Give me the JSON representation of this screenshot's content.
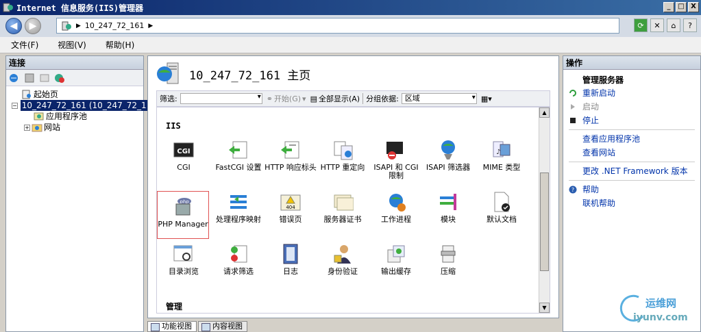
{
  "window": {
    "title": "Internet 信息服务(IIS)管理器",
    "buttons": [
      "_",
      "□",
      "X"
    ]
  },
  "address": {
    "crumb": "10_247_72_161"
  },
  "menu": [
    "文件(F)",
    "视图(V)",
    "帮助(H)"
  ],
  "connections": {
    "header": "连接",
    "tree": [
      {
        "label": "起始页"
      },
      {
        "label": "10_247_72_161 (10_247_72_1"
      },
      {
        "label": "应用程序池"
      },
      {
        "label": "网站"
      }
    ]
  },
  "center": {
    "title": "10_247_72_161 主页",
    "filter": {
      "label": "筛选:",
      "start": "开始(G)",
      "show_all": "全部显示(A)",
      "group_by_label": "分组依据:",
      "group_by_value": "区域"
    },
    "sections": {
      "iis": "IIS",
      "manage": "管理"
    },
    "features": [
      {
        "label": "CGI",
        "icon": "cgi-icon"
      },
      {
        "label": "FastCGI 设置",
        "icon": "fastcgi-icon"
      },
      {
        "label": "HTTP 响应标头",
        "icon": "http-headers-icon"
      },
      {
        "label": "HTTP 重定向",
        "icon": "http-redirect-icon"
      },
      {
        "label": "ISAPI 和 CGI 限制",
        "icon": "isapi-cgi-icon"
      },
      {
        "label": "ISAPI 筛选器",
        "icon": "isapi-filter-icon"
      },
      {
        "label": "MIME 类型",
        "icon": "mime-icon"
      },
      {
        "label": "PHP Manager",
        "icon": "php-manager-icon"
      },
      {
        "label": "处理程序映射",
        "icon": "handler-mapping-icon"
      },
      {
        "label": "错误页",
        "icon": "error-page-icon"
      },
      {
        "label": "服务器证书",
        "icon": "certificate-icon"
      },
      {
        "label": "工作进程",
        "icon": "worker-process-icon"
      },
      {
        "label": "模块",
        "icon": "modules-icon"
      },
      {
        "label": "默认文档",
        "icon": "default-document-icon"
      },
      {
        "label": "目录浏览",
        "icon": "directory-browsing-icon"
      },
      {
        "label": "请求筛选",
        "icon": "request-filter-icon"
      },
      {
        "label": "日志",
        "icon": "logging-icon"
      },
      {
        "label": "身份验证",
        "icon": "authentication-icon"
      },
      {
        "label": "输出缓存",
        "icon": "output-cache-icon"
      },
      {
        "label": "压缩",
        "icon": "compression-icon"
      }
    ],
    "tabs": [
      "功能视图",
      "内容视图"
    ]
  },
  "actions": {
    "header": "操作",
    "group_title": "管理服务器",
    "items": [
      {
        "label": "重新启动",
        "enabled": true
      },
      {
        "label": "启动",
        "enabled": false
      },
      {
        "label": "停止",
        "enabled": true
      },
      {
        "label": "查看应用程序池",
        "enabled": true
      },
      {
        "label": "查看网站",
        "enabled": true
      },
      {
        "label": "更改 .NET Framework 版本",
        "enabled": true
      },
      {
        "label": "帮助",
        "enabled": true
      },
      {
        "label": "联机帮助",
        "enabled": true
      }
    ]
  },
  "watermark": {
    "text": "运维网",
    "url": "iyunv.com"
  }
}
